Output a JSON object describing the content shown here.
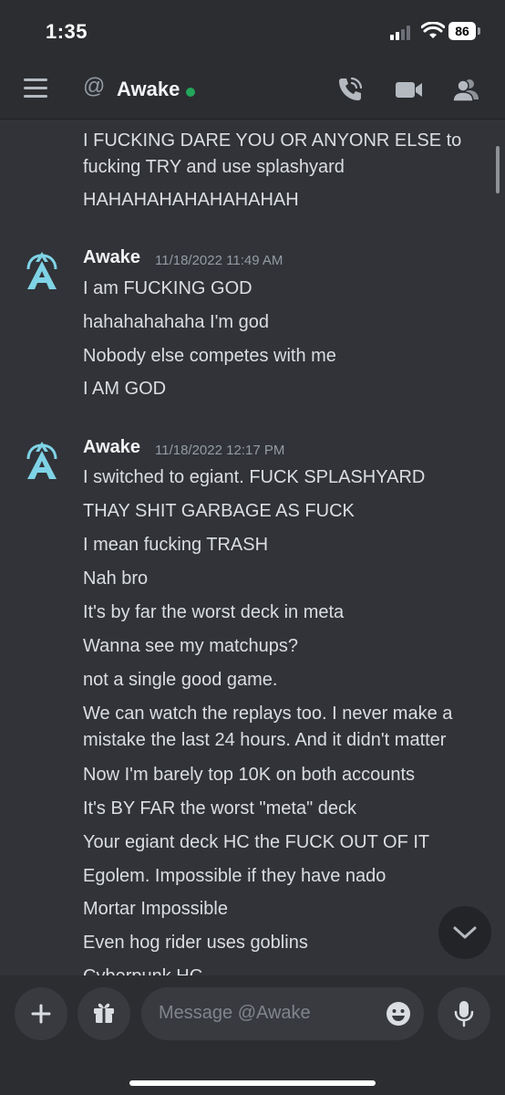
{
  "status_bar": {
    "time": "1:35",
    "battery": "86"
  },
  "header": {
    "at_symbol": "@",
    "channel_name": "Awake",
    "presence_color": "#23a55a"
  },
  "messages": {
    "continuation": [
      "I FUCKING DARE YOU OR ANYONR ELSE to",
      "fucking TRY and use splashyard",
      "HAHAHAHAHAHAHAHAH"
    ],
    "groups": [
      {
        "author": "Awake",
        "timestamp": "11/18/2022 11:49 AM",
        "lines": [
          "I am FUCKING GOD",
          "hahahahahaha I'm god",
          "Nobody else competes with me",
          "I AM GOD"
        ]
      },
      {
        "author": "Awake",
        "timestamp": "11/18/2022 12:17 PM",
        "lines": [
          "I switched to egiant. FUCK SPLASHYARD",
          "THAY SHIT GARBAGE AS FUCK",
          "I mean fucking TRASH",
          "Nah bro",
          "It's by far the worst deck in meta",
          "Wanna see my matchups?",
          "not a single good game.",
          "We can watch the replays too. I never make a",
          "mistake the last 24 hours. And it didn't matter",
          "Now I'm barely top 10K on both accounts",
          "It's BY FAR the worst \"meta\" deck",
          "Your egiant deck HC the FUCK OUT OF IT",
          "Egolem. Impossible if they have nado",
          "Mortar Impossible",
          "Even hog rider uses goblins",
          "Cyberpunk HC"
        ]
      }
    ]
  },
  "composer": {
    "placeholder": "Message @Awake"
  },
  "icons": {
    "menu": "hamburger-icon",
    "call": "phone-call-icon",
    "video": "video-camera-icon",
    "members": "members-icon",
    "add": "plus-icon",
    "gift": "gift-icon",
    "emoji": "emoji-icon",
    "mic": "microphone-icon",
    "scroll": "chevron-down-icon"
  },
  "colors": {
    "background": "#313338",
    "header": "#2b2d31",
    "text": "#dbdee1",
    "avatar": "#7fd3e6"
  }
}
